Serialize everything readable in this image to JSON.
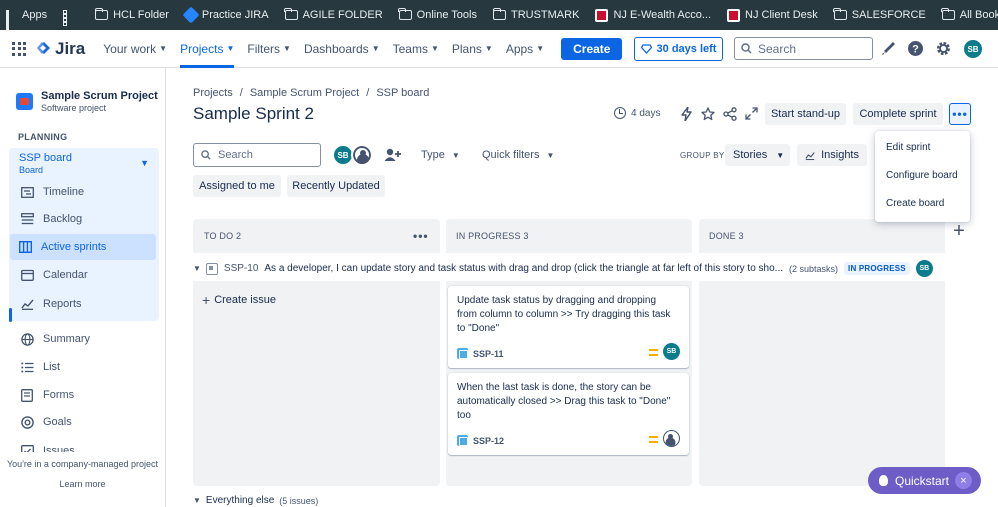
{
  "bookmarks": {
    "apps_label": "Apps",
    "items": [
      "HCL Folder",
      "Practice JIRA",
      "AGILE FOLDER",
      "Online Tools",
      "TRUSTMARK",
      "NJ E-Wealth Acco...",
      "NJ Client Desk",
      "SALESFORCE"
    ],
    "all_label": "All Bookmarks"
  },
  "topnav": {
    "logo": "Jira",
    "items": [
      "Your work",
      "Projects",
      "Filters",
      "Dashboards",
      "Teams",
      "Plans",
      "Apps"
    ],
    "active_item": "Projects",
    "create_label": "Create",
    "trial_label": "30 days left",
    "search_placeholder": "Search",
    "avatar_initials": "SB",
    "accent": "#0c66e4"
  },
  "sidebar": {
    "project_name": "Sample Scrum Project",
    "project_type": "Software project",
    "planning_label": "PLANNING",
    "board_name": "SSP board",
    "board_sub": "Board",
    "items": [
      {
        "label": "Timeline",
        "icon": "timeline-icon"
      },
      {
        "label": "Backlog",
        "icon": "backlog-icon"
      },
      {
        "label": "Active sprints",
        "icon": "board-icon"
      },
      {
        "label": "Calendar",
        "icon": "calendar-icon"
      },
      {
        "label": "Reports",
        "icon": "reports-icon"
      },
      {
        "label": "Summary",
        "icon": "globe-icon"
      },
      {
        "label": "List",
        "icon": "list-icon"
      },
      {
        "label": "Forms",
        "icon": "forms-icon"
      },
      {
        "label": "Goals",
        "icon": "goals-icon"
      },
      {
        "label": "Issues",
        "icon": "issues-icon"
      }
    ],
    "footer_text": "You're in a company-managed project",
    "learn_more": "Learn more"
  },
  "main": {
    "breadcrumb": [
      "Projects",
      "Sample Scrum Project",
      "SSP board"
    ],
    "title": "Sample Sprint 2",
    "days_left": "4 days",
    "standup_label": "Start stand-up",
    "complete_label": "Complete sprint",
    "search_placeholder": "Search",
    "avatar_initials": "SB",
    "type_label": "Type",
    "quick_filters_label": "Quick filters",
    "group_by_label": "GROUP BY",
    "group_by_value": "Stories",
    "insights_label": "Insights",
    "chips": [
      "Assigned to me",
      "Recently Updated"
    ]
  },
  "menu": {
    "items": [
      "Edit sprint",
      "Configure board",
      "Create board"
    ]
  },
  "columns": [
    {
      "label": "TO DO 2"
    },
    {
      "label": "IN PROGRESS 3"
    },
    {
      "label": "DONE 3"
    }
  ],
  "swimlane": {
    "key": "SSP-10",
    "summary": "As a developer, I can update story and task status with drag and drop (click the triangle at far left of this story to sho...",
    "subtasks": "(2 subtasks)",
    "status": "IN PROGRESS",
    "avatar_initials": "SB"
  },
  "create_issue_label": "Create issue",
  "cards": [
    {
      "text": "Update task status by dragging and dropping from column to column >> Try dragging this task to \"Done\"",
      "key": "SSP-11",
      "avatar_initials": "SB"
    },
    {
      "text": "When the last task is done, the story can be automatically closed >> Drag this task to \"Done\" too",
      "key": "SSP-12",
      "avatar_initials": ""
    }
  ],
  "everything_else": {
    "label": "Everything else",
    "count": "(5 issues)"
  },
  "quickstart": {
    "label": "Quickstart",
    "close": "×"
  }
}
